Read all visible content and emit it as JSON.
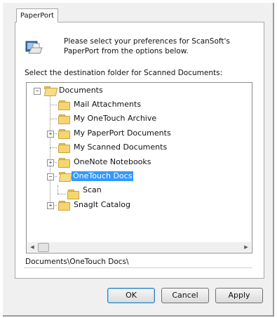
{
  "tab": {
    "label": "PaperPort"
  },
  "intro": {
    "text": "Please select your preferences for ScanSoft's PaperPort from the options below."
  },
  "destination": {
    "label": "Select the destination folder for Scanned Documents:"
  },
  "tree": {
    "root": "Documents",
    "items": [
      "Mail Attachments",
      "My OneTouch Archive",
      "My PaperPort Documents",
      "My Scanned Documents",
      "OneNote Notebooks",
      "OneTouch Docs",
      "Scan",
      "SnagIt Catalog"
    ]
  },
  "path": {
    "value": "Documents\\OneTouch Docs\\"
  },
  "buttons": {
    "ok": "OK",
    "cancel": "Cancel",
    "apply": "Apply"
  },
  "colors": {
    "selection": "#3399ff",
    "folder": "#f4d56f"
  }
}
